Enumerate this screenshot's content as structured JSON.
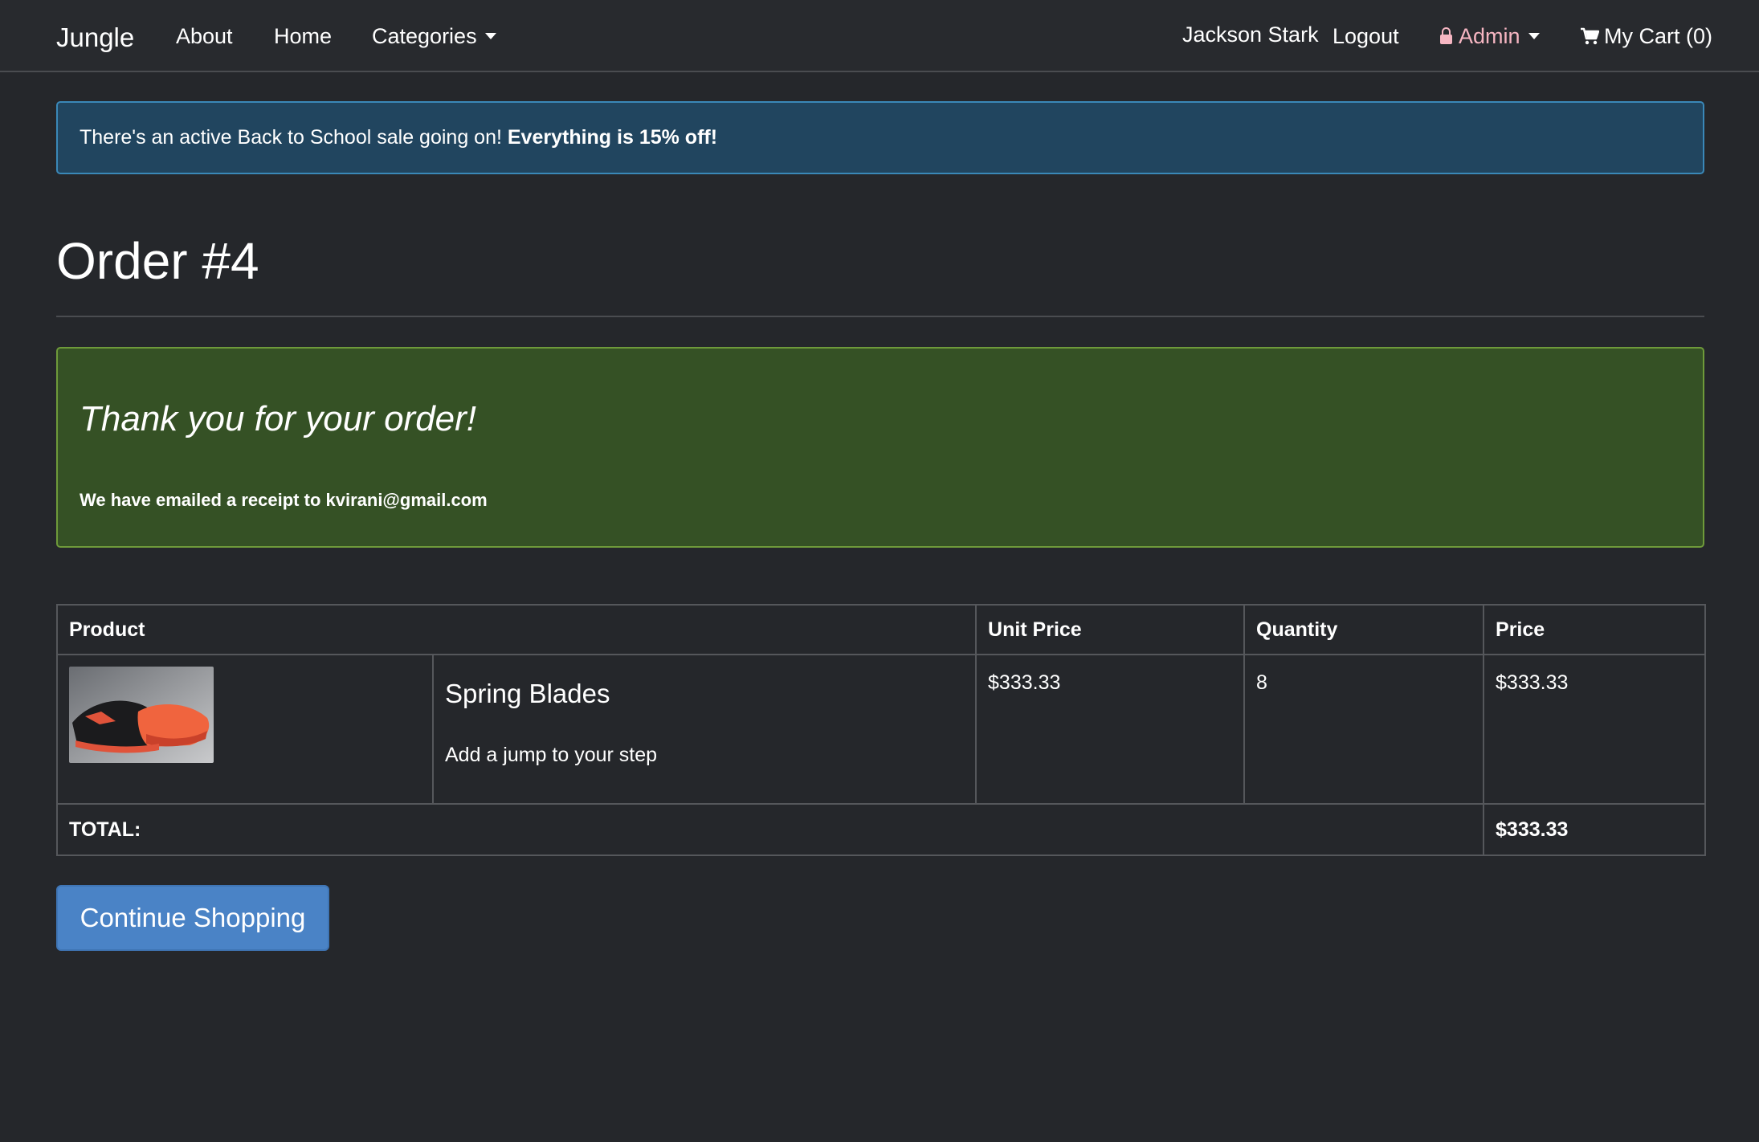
{
  "navbar": {
    "brand": "Jungle",
    "links": {
      "about": "About",
      "home": "Home",
      "categories": "Categories"
    },
    "user_name": "Jackson Stark",
    "logout": "Logout",
    "admin": "Admin",
    "cart": "My Cart (0)"
  },
  "sale_alert": {
    "text": "There's an active Back to School sale going on! ",
    "emphasis": "Everything is 15% off!"
  },
  "page": {
    "title": "Order #4"
  },
  "thanks": {
    "title": "Thank you for your order!",
    "subtitle": "We have emailed a receipt to kvirani@gmail.com"
  },
  "table": {
    "headers": {
      "product": "Product",
      "unit_price": "Unit Price",
      "quantity": "Quantity",
      "price": "Price"
    },
    "items": [
      {
        "name": "Spring Blades",
        "description": "Add a jump to your step",
        "unit_price": "$333.33",
        "quantity": "8",
        "price": "$333.33"
      }
    ],
    "total_label": "TOTAL:",
    "total_value": "$333.33"
  },
  "actions": {
    "continue": "Continue Shopping"
  },
  "colors": {
    "background": "#25272b",
    "alert_info": "#21455f",
    "alert_success": "#355125",
    "primary_button": "#4a83c6",
    "admin_link": "#f6b6c2"
  }
}
